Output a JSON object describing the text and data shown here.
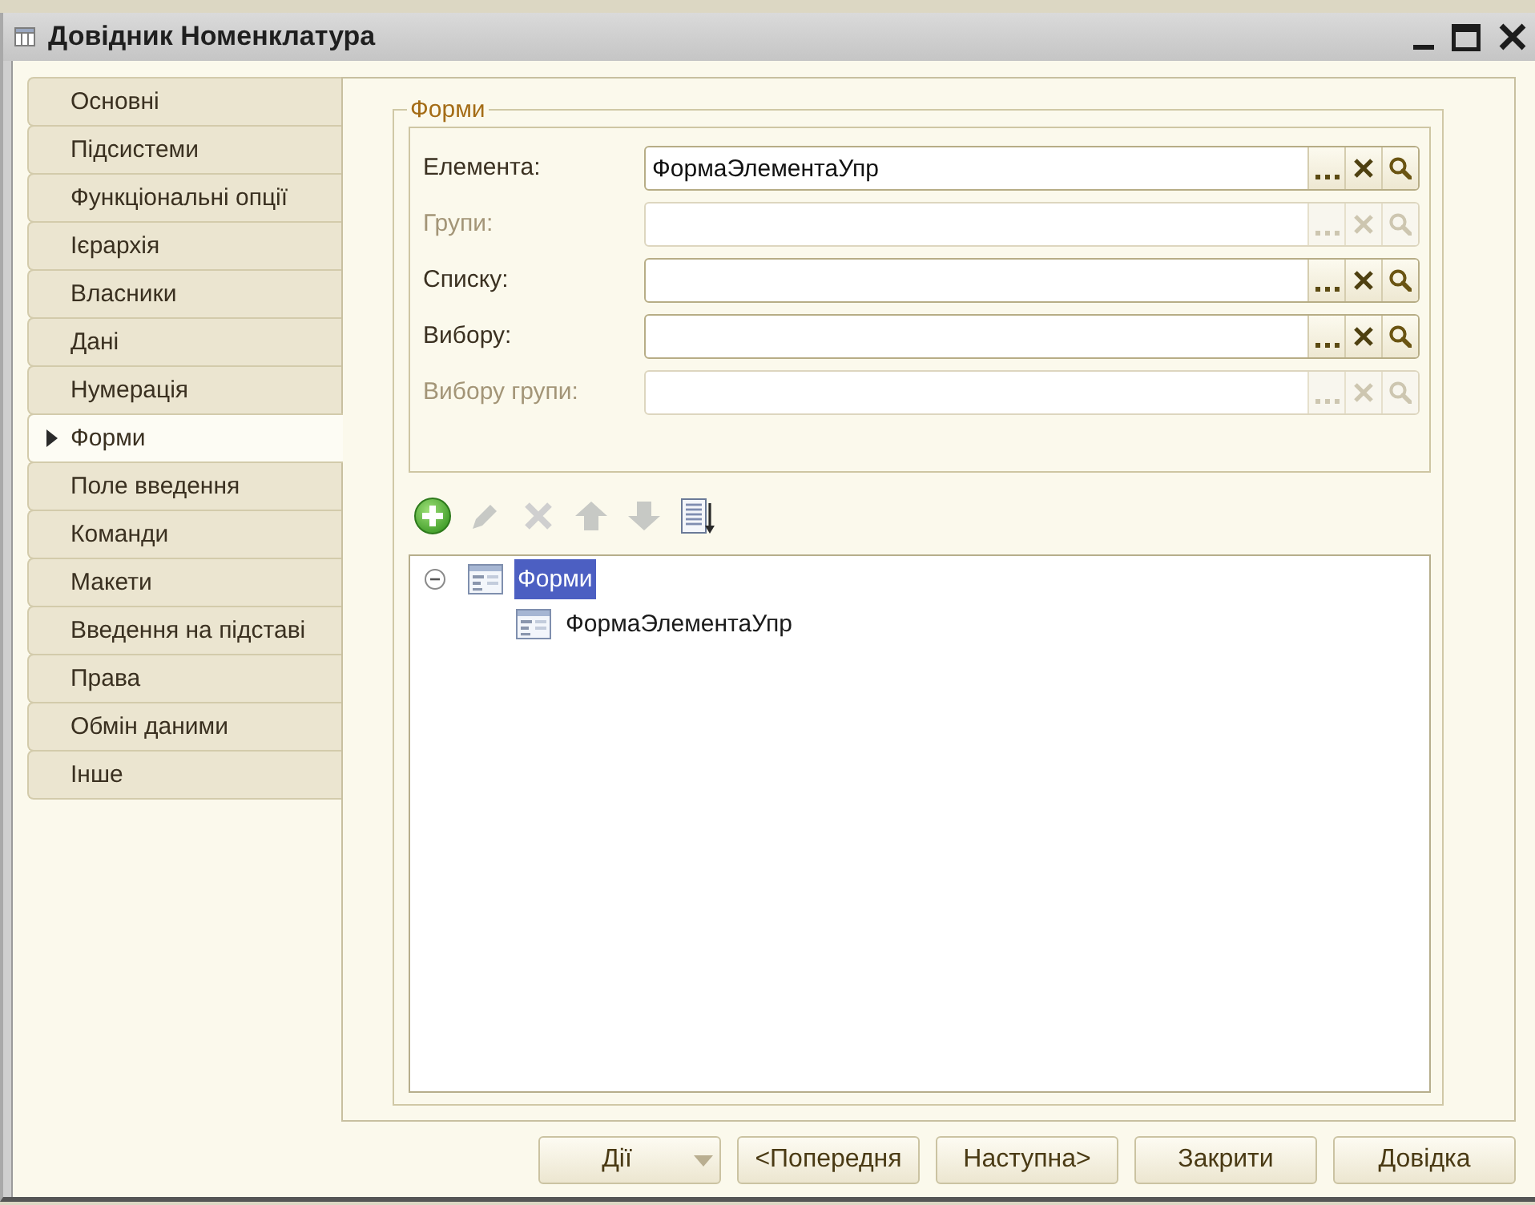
{
  "window": {
    "title": "Довідник Номенклатура"
  },
  "sidebar": {
    "items": [
      {
        "label": "Основні",
        "selected": false
      },
      {
        "label": "Підсистеми",
        "selected": false
      },
      {
        "label": "Функціональні опції",
        "selected": false
      },
      {
        "label": "Ієрархія",
        "selected": false
      },
      {
        "label": "Власники",
        "selected": false
      },
      {
        "label": "Дані",
        "selected": false
      },
      {
        "label": "Нумерація",
        "selected": false
      },
      {
        "label": "Форми",
        "selected": true
      },
      {
        "label": "Поле введення",
        "selected": false
      },
      {
        "label": "Команди",
        "selected": false
      },
      {
        "label": "Макети",
        "selected": false
      },
      {
        "label": "Введення на підставі",
        "selected": false
      },
      {
        "label": "Права",
        "selected": false
      },
      {
        "label": "Обмін даними",
        "selected": false
      },
      {
        "label": "Інше",
        "selected": false
      }
    ]
  },
  "forms_group": {
    "title": "Форми",
    "fields": [
      {
        "label": "Елемента:",
        "value": "ФормаЭлементаУпр",
        "disabled": false
      },
      {
        "label": "Групи:",
        "disabled": true
      },
      {
        "label": "Списку:",
        "disabled": false
      },
      {
        "label": "Вибору:",
        "disabled": false
      },
      {
        "label": "Вибору групи:",
        "disabled": true
      }
    ],
    "toolbar": [
      {
        "kind": "add",
        "disabled": false
      },
      {
        "kind": "edit",
        "disabled": true
      },
      {
        "kind": "delete",
        "disabled": true
      },
      {
        "kind": "move_up",
        "disabled": true
      },
      {
        "kind": "move_down",
        "disabled": true
      },
      {
        "kind": "sort",
        "disabled": false
      }
    ],
    "tree": [
      {
        "label": "Форми",
        "expanded": true,
        "selected": true,
        "children": [
          {
            "label": "ФормаЭлементаУпр",
            "selected": false
          }
        ]
      }
    ]
  },
  "buttons": [
    {
      "label": "Дії",
      "kind": "dropdown"
    },
    {
      "label": "<Попередня",
      "kind": "plain"
    },
    {
      "label": "Наступна>",
      "kind": "plain"
    },
    {
      "label": "Закрити",
      "kind": "plain"
    },
    {
      "label": "Довідка",
      "kind": "plain"
    }
  ]
}
